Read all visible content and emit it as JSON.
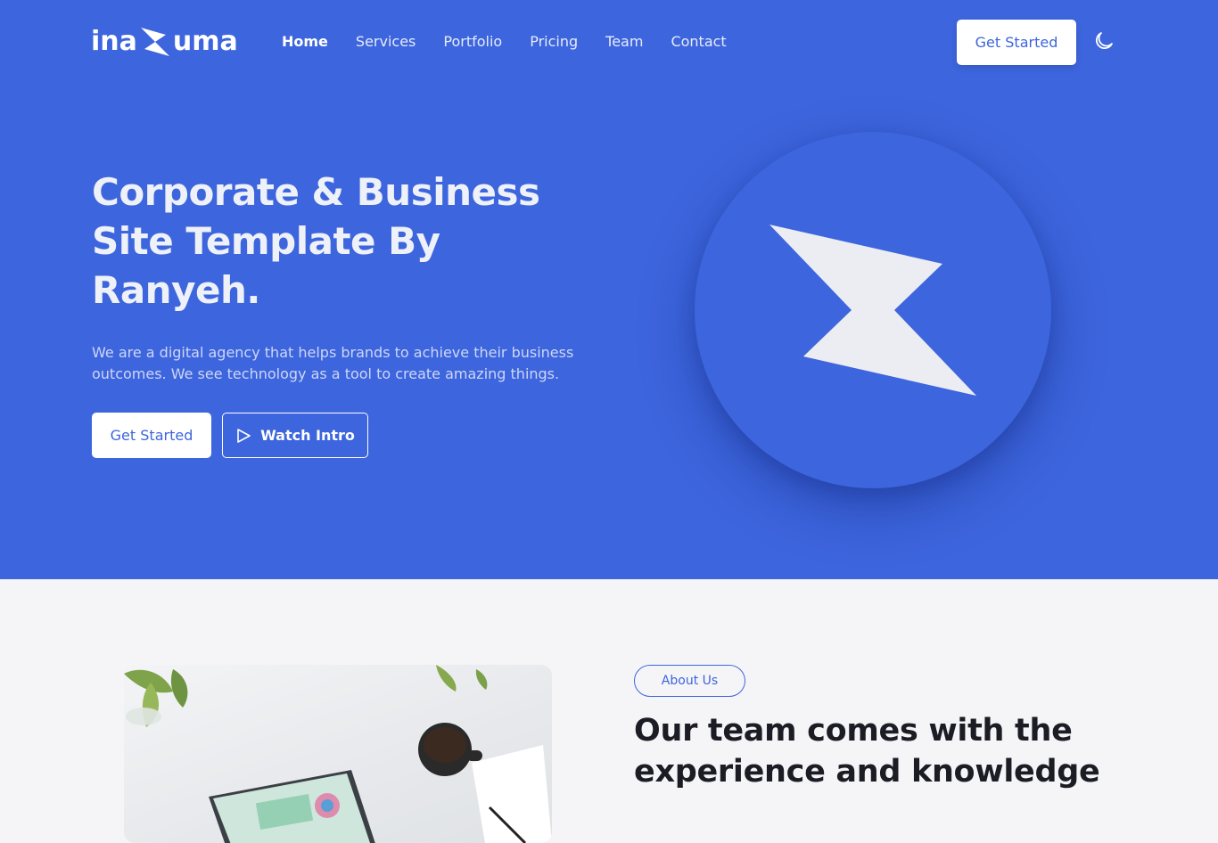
{
  "brand": {
    "logo_left": "ina",
    "logo_right": "uma",
    "accent_color": "#3d65dd",
    "light_color": "#ffffff"
  },
  "nav": {
    "items": [
      {
        "label": "Home",
        "active": true
      },
      {
        "label": "Services",
        "active": false
      },
      {
        "label": "Portfolio",
        "active": false
      },
      {
        "label": "Pricing",
        "active": false
      },
      {
        "label": "Team",
        "active": false
      },
      {
        "label": "Contact",
        "active": false
      }
    ]
  },
  "header": {
    "cta_label": "Get Started",
    "theme_icon": "moon-icon"
  },
  "hero": {
    "title": "Corporate & Business Site Template By Ranyeh.",
    "description": "We are a digital agency that helps brands to achieve their business outcomes. We see technology as a tool to create amazing things.",
    "primary_label": "Get Started",
    "secondary_label": "Watch Intro",
    "secondary_icon": "play-icon",
    "graphic_icon": "lightning-bolt-icon"
  },
  "about": {
    "badge": "About Us",
    "title": "Our team comes with the experience and knowledge",
    "image_icon": "laptop-workspace-photo"
  }
}
